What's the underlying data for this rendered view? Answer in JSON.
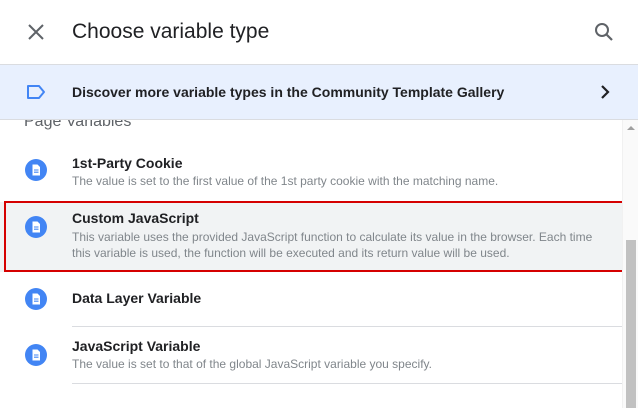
{
  "header": {
    "title": "Choose variable type",
    "close_icon": "close-icon",
    "search_icon": "search-icon"
  },
  "banner": {
    "text": "Discover more variable types in the Community Template Gallery",
    "icon": "label-tag-icon",
    "chevron": "chevron-right-icon"
  },
  "section": {
    "title": "Page Variables"
  },
  "items": [
    {
      "name": "1st-Party Cookie",
      "description": "The value is set to the first value of the 1st party cookie with the matching name."
    },
    {
      "name": "Custom JavaScript",
      "description": "This variable uses the provided JavaScript function to calculate its value in the browser. Each time this variable is used, the function will be executed and its return value will be used."
    },
    {
      "name": "Data Layer Variable",
      "description": ""
    },
    {
      "name": "JavaScript Variable",
      "description": "The value is set to that of the global JavaScript variable you specify."
    }
  ],
  "colors": {
    "accent": "#4285f4",
    "banner_bg": "#e8f0fe",
    "highlight_border": "#d50000",
    "highlight_bg": "#f1f3f4"
  }
}
